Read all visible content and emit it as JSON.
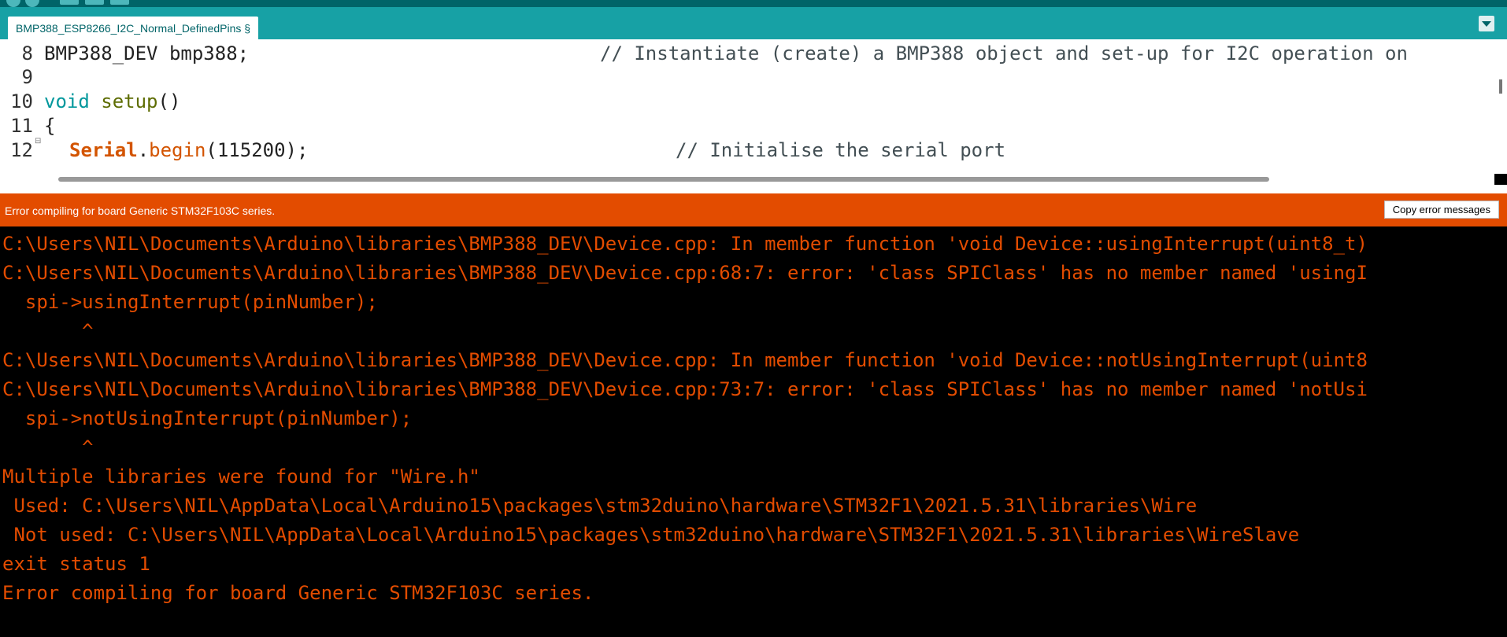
{
  "tab": {
    "label": "BMP388_ESP8266_I2C_Normal_DefinedPins §"
  },
  "editor": {
    "line_numbers": [
      "8",
      "9",
      "10",
      "11",
      "12"
    ],
    "lines": {
      "l8_code": "BMP388_DEV bmp388;",
      "l8_comment": "// Instantiate (create) a BMP388 object and set-up for I2C operation on",
      "l10_kw": "void",
      "l10_fn": "setup",
      "l10_rest": "()",
      "l11": "{",
      "l12_obj": "Serial",
      "l12_dot": ".",
      "l12_fn": "begin",
      "l12_rest": "(115200);",
      "l12_comment": "// Initialise the serial port"
    }
  },
  "status": {
    "message": "Error compiling for board Generic STM32F103C series.",
    "copy_button": "Copy error messages"
  },
  "console": {
    "lines": [
      "C:\\Users\\NIL\\Documents\\Arduino\\libraries\\BMP388_DEV\\Device.cpp: In member function 'void Device::usingInterrupt(uint8_t)",
      "C:\\Users\\NIL\\Documents\\Arduino\\libraries\\BMP388_DEV\\Device.cpp:68:7: error: 'class SPIClass' has no member named 'usingI",
      "  spi->usingInterrupt(pinNumber);",
      "       ^",
      "C:\\Users\\NIL\\Documents\\Arduino\\libraries\\BMP388_DEV\\Device.cpp: In member function 'void Device::notUsingInterrupt(uint8",
      "C:\\Users\\NIL\\Documents\\Arduino\\libraries\\BMP388_DEV\\Device.cpp:73:7: error: 'class SPIClass' has no member named 'notUsi",
      "  spi->notUsingInterrupt(pinNumber);",
      "       ^",
      "Multiple libraries were found for \"Wire.h\"",
      " Used: C:\\Users\\NIL\\AppData\\Local\\Arduino15\\packages\\stm32duino\\hardware\\STM32F1\\2021.5.31\\libraries\\Wire",
      " Not used: C:\\Users\\NIL\\AppData\\Local\\Arduino15\\packages\\stm32duino\\hardware\\STM32F1\\2021.5.31\\libraries\\WireSlave",
      "exit status 1",
      "Error compiling for board Generic STM32F103C series."
    ]
  },
  "colors": {
    "toolbar": "#006468",
    "tab_strip": "#17a1a5",
    "error_bar": "#e34c00",
    "console_text": "#e34c00",
    "console_bg": "#000000"
  }
}
